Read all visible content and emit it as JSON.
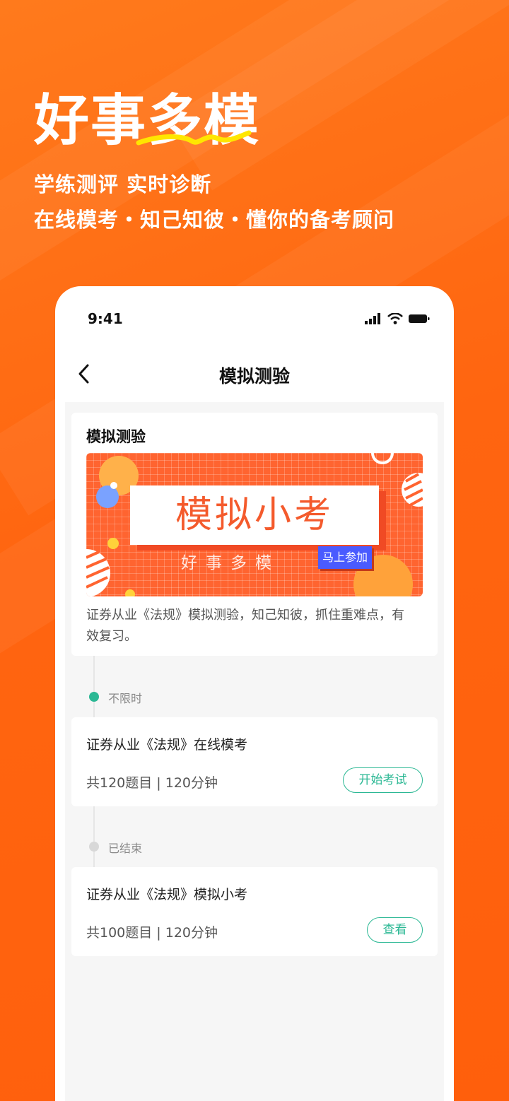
{
  "hero": {
    "title": "好事多模",
    "subtitle_line1": "学练测评 实时诊断",
    "subtitle_line2": "在线模考・知己知彼・懂你的备考顾问"
  },
  "status_bar": {
    "time": "9:41",
    "icons": [
      "cellular-signal-icon",
      "wifi-icon",
      "battery-icon"
    ]
  },
  "nav": {
    "back_icon": "chevron-left-icon",
    "title": "模拟测验"
  },
  "intro_card": {
    "title": "模拟测验",
    "banner": {
      "headline": "模拟小考",
      "subtitle": "好事多模",
      "join_label": "马上参加"
    },
    "description": "证券从业《法规》模拟测验，知己知彼，抓住重难点，有效复习。"
  },
  "sections": [
    {
      "status": "不限时",
      "status_color": "#2bb894",
      "exam": {
        "title": "证券从业《法规》在线模考",
        "meta": "共120题目 | 120分钟",
        "action": "开始考试"
      }
    },
    {
      "status": "已结束",
      "status_color": "#d8d8d8",
      "exam": {
        "title": "证券从业《法规》模拟小考",
        "meta": "共100题目 | 120分钟",
        "action": "查看"
      }
    }
  ],
  "colors": {
    "brand_orange": "#ff6a12",
    "accent_green": "#2bb894",
    "underline_yellow": "#ffe600"
  }
}
